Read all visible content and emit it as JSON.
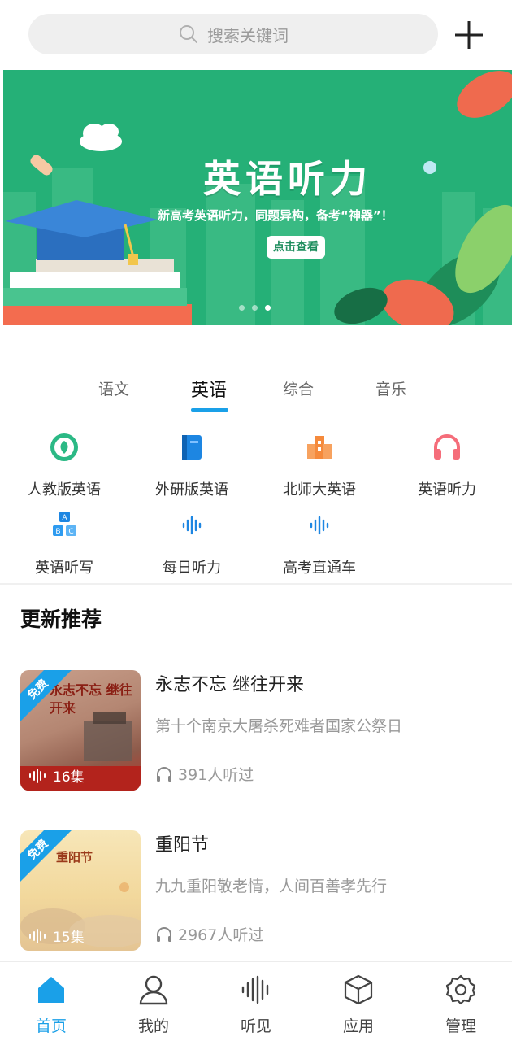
{
  "search": {
    "placeholder": "搜索关键词"
  },
  "banner": {
    "title": "英语听力",
    "subtitle": "新高考英语听力，同题异构，备考“神器”！",
    "button": "点击查看",
    "dots": 3,
    "active_dot": 3
  },
  "tabs": [
    {
      "label": "语文",
      "active": false
    },
    {
      "label": "英语",
      "active": true
    },
    {
      "label": "综合",
      "active": false
    },
    {
      "label": "音乐",
      "active": false
    }
  ],
  "categories": [
    {
      "label": "人教版英语",
      "icon": "rj-logo-icon"
    },
    {
      "label": "外研版英语",
      "icon": "blue-book-icon"
    },
    {
      "label": "北师大英语",
      "icon": "building-icon"
    },
    {
      "label": "英语听力",
      "icon": "headphones-icon"
    },
    {
      "label": "英语听写",
      "icon": "abc-blocks-icon"
    },
    {
      "label": "每日听力",
      "icon": "waveform-icon"
    },
    {
      "label": "高考直通车",
      "icon": "waveform-icon"
    }
  ],
  "section_title": "更新推荐",
  "list": [
    {
      "title": "永志不忘 继往开来",
      "subtitle": "第十个南京大屠杀死难者国家公祭日",
      "listens": "391人听过",
      "badge": "免费",
      "episodes": "16集",
      "thumb_text": "永志不忘 继往开来"
    },
    {
      "title": "重阳节",
      "subtitle": "九九重阳敬老情，人间百善孝先行",
      "listens": "2967人听过",
      "badge": "免费",
      "episodes": "15集",
      "thumb_text": "重阳节"
    }
  ],
  "nav": [
    {
      "label": "首页",
      "icon": "home-icon",
      "active": true
    },
    {
      "label": "我的",
      "icon": "user-icon",
      "active": false
    },
    {
      "label": "听见",
      "icon": "waveform-icon",
      "active": false
    },
    {
      "label": "应用",
      "icon": "cube-icon",
      "active": false
    },
    {
      "label": "管理",
      "icon": "gear-icon",
      "active": false
    }
  ],
  "colors": {
    "accent": "#1aa0e8",
    "banner_green": "#25b077"
  }
}
